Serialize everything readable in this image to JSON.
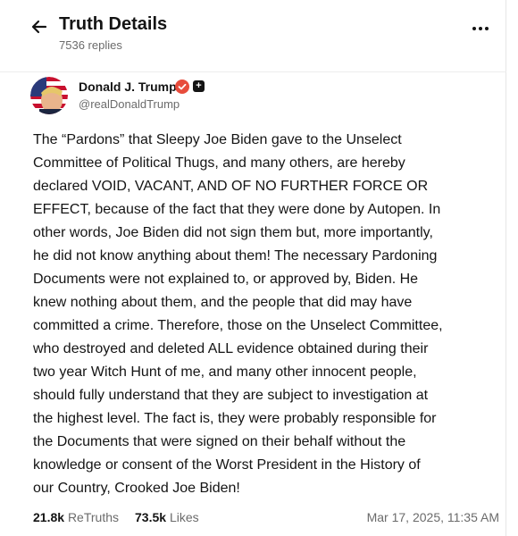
{
  "header": {
    "title": "Truth Details",
    "replies": "7536 replies",
    "back_icon": "arrow-left-icon",
    "more_icon": "more-horizontal-icon"
  },
  "author": {
    "name": "Donald J. Trump",
    "handle": "@realDonaldTrump",
    "verified_icon": "verified-badge-icon",
    "badge_icon": "plus-badge-icon",
    "badge_glyph": "+"
  },
  "post": {
    "text": "The “Pardons” that Sleepy Joe Biden gave to the Unselect\nCommittee of Political Thugs, and many others, are hereby\ndeclared VOID, VACANT, AND OF NO FURTHER FORCE OR\nEFFECT, because of the fact that they were done by Autopen. In\nother words, Joe Biden did not sign them but, more importantly,\nhe did not know anything about them! The necessary Pardoning\nDocuments were not explained to, or approved by, Biden. He\nknew nothing about them, and the people that did may have\ncommitted a crime. Therefore, those on the Unselect Committee,\nwho destroyed and deleted ALL evidence obtained during their\ntwo year Witch Hunt of me, and many other innocent people,\nshould fully understand that they are subject to investigation at\nthe highest level. The fact is, they were probably responsible for\nthe Documents that were signed on their behalf without the\nknowledge or consent of the Worst President in the History of\nour Country, Crooked Joe Biden!"
  },
  "stats": {
    "retruths_count": "21.8k",
    "retruths_label": "ReTruths",
    "likes_count": "73.5k",
    "likes_label": "Likes",
    "timestamp": "Mar 17, 2025, 11:35 AM"
  },
  "colors": {
    "verified": "#e74c3c",
    "text": "#141414",
    "muted": "#6b6b6b"
  }
}
